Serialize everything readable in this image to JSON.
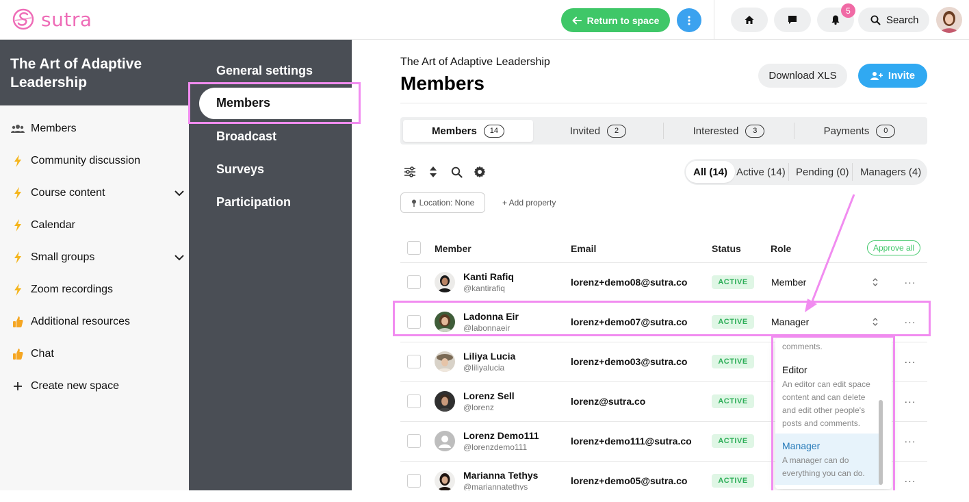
{
  "topbar": {
    "brand": "sutra",
    "return_label": "Return to space",
    "notification_count": "5",
    "search_label": "Search"
  },
  "space": {
    "title": "The Art of Adaptive Leadership"
  },
  "sidebar": {
    "items": [
      {
        "label": "Members",
        "icon": "people-icon"
      },
      {
        "label": "Community discussion",
        "icon": "lightning-icon"
      },
      {
        "label": "Course content",
        "icon": "lightning-icon",
        "expandable": true
      },
      {
        "label": "Calendar",
        "icon": "lightning-icon"
      },
      {
        "label": "Small groups",
        "icon": "lightning-icon",
        "expandable": true
      },
      {
        "label": "Zoom recordings",
        "icon": "lightning-icon"
      },
      {
        "label": "Additional resources",
        "icon": "thumbs-up-icon"
      },
      {
        "label": "Chat",
        "icon": "thumbs-up-icon"
      },
      {
        "label": "Create new space",
        "icon": "plus-icon"
      }
    ]
  },
  "settings_nav": {
    "items": [
      "General settings",
      "Members",
      "Broadcast",
      "Surveys",
      "Participation"
    ],
    "active": "Members"
  },
  "main": {
    "breadcrumb": "The Art of Adaptive Leadership",
    "title": "Members",
    "download_label": "Download XLS",
    "invite_label": "Invite",
    "tabs": [
      {
        "label": "Members",
        "count": "14"
      },
      {
        "label": "Invited",
        "count": "2"
      },
      {
        "label": "Interested",
        "count": "3"
      },
      {
        "label": "Payments",
        "count": "0"
      }
    ],
    "filters": [
      "All (14)",
      "Active (14)",
      "Pending (0)",
      "Managers (4)"
    ],
    "location_chip": "Location: None",
    "add_property": "+ Add property",
    "columns": {
      "member": "Member",
      "email": "Email",
      "status": "Status",
      "role": "Role"
    },
    "approve_all": "Approve all",
    "rows": [
      {
        "name": "Kanti Rafiq",
        "handle": "@kantirafiq",
        "email": "lorenz+demo08@sutra.co",
        "status": "ACTIVE",
        "role": "Member"
      },
      {
        "name": "Ladonna Eir",
        "handle": "@labonnaeir",
        "email": "lorenz+demo07@sutra.co",
        "status": "ACTIVE",
        "role": "Manager"
      },
      {
        "name": "Liliya Lucia",
        "handle": "@liliyalucia",
        "email": "lorenz+demo03@sutra.co",
        "status": "ACTIVE",
        "role": ""
      },
      {
        "name": "Lorenz Sell",
        "handle": "@lorenz",
        "email": "lorenz@sutra.co",
        "status": "ACTIVE",
        "role": ""
      },
      {
        "name": "Lorenz Demo111",
        "handle": "@lorenzdemo111",
        "email": "lorenz+demo111@sutra.co",
        "status": "ACTIVE",
        "role": ""
      },
      {
        "name": "Marianna Tethys",
        "handle": "@mariannatethys",
        "email": "lorenz+demo05@sutra.co",
        "status": "ACTIVE",
        "role": ""
      }
    ],
    "role_dropdown": {
      "partial_text": "comments.",
      "options": [
        {
          "title": "Editor",
          "desc": "An editor can edit space content and can delete and edit other people's posts and comments."
        },
        {
          "title": "Manager",
          "desc": "A manager can do everything you can do."
        }
      ],
      "selected": "Manager"
    }
  },
  "colors": {
    "brand_pink": "#ee6cb7",
    "return_green": "#3fc768",
    "invite_blue": "#30a9f2",
    "sidebar_dark": "#4a4e55",
    "highlight_pink": "#f18cf0",
    "active_green": "#2cae57"
  }
}
